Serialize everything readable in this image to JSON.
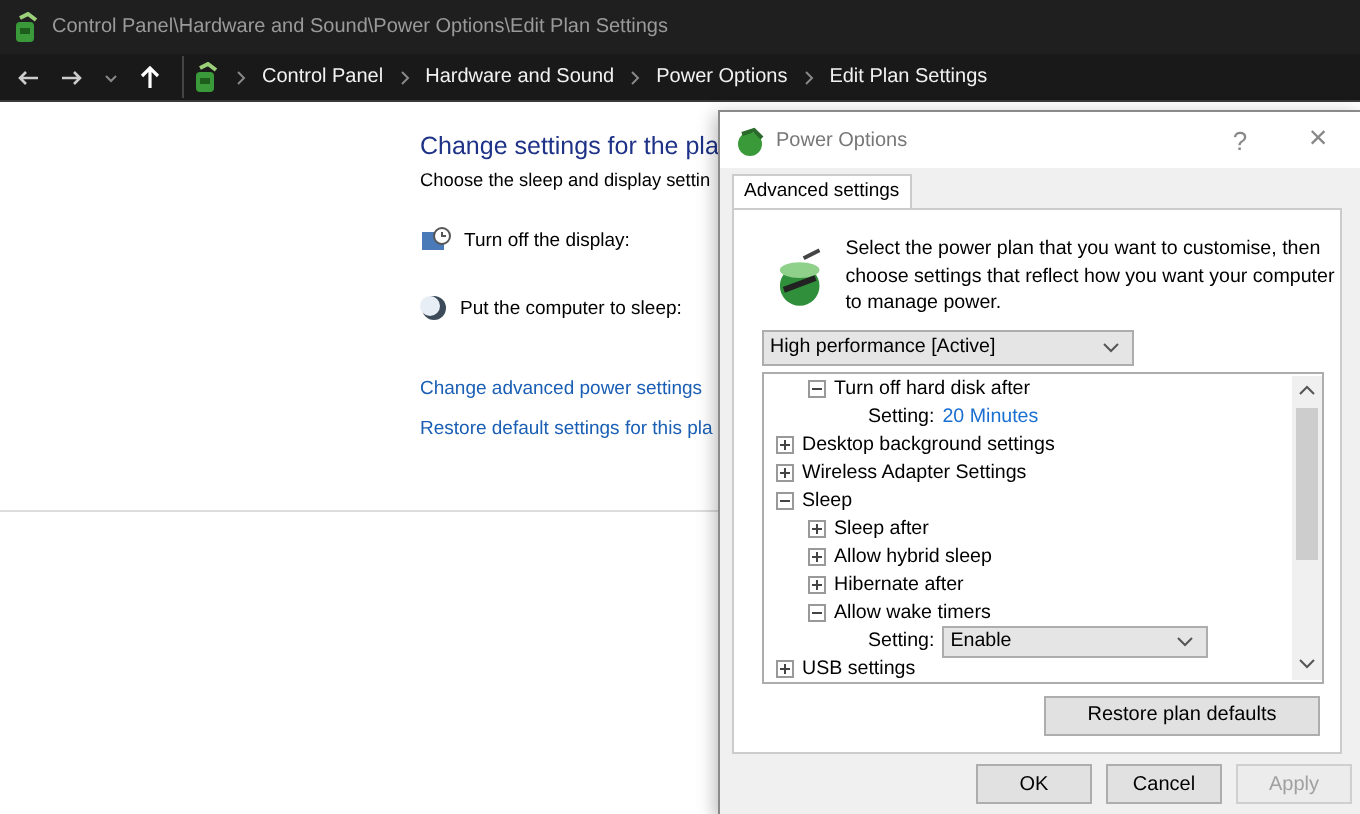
{
  "window": {
    "title": "Control Panel\\Hardware and Sound\\Power Options\\Edit Plan Settings"
  },
  "address_bar": {
    "breadcrumbs": [
      "Control Panel",
      "Hardware and Sound",
      "Power Options",
      "Edit Plan Settings"
    ]
  },
  "main": {
    "heading": "Change settings for the pla",
    "subheading": "Choose the sleep and display settin",
    "settings": [
      {
        "label": "Turn off the display:",
        "kind": "display"
      },
      {
        "label": "Put the computer to sleep:",
        "kind": "sleep"
      }
    ],
    "links": [
      "Change advanced power settings",
      "Restore default settings for this pla"
    ]
  },
  "dialog": {
    "title": "Power Options",
    "help": "?",
    "close": "×",
    "tabs": [
      {
        "label": "Advanced settings",
        "selected": true
      }
    ],
    "description": "Select the power plan that you want to customise, then choose settings that reflect how you want your computer to manage power.",
    "plan": "High performance [Active]",
    "tree": [
      {
        "children": [
          {
            "label": "Turn off hard disk after",
            "expanded": true,
            "setting": {
              "label": "Setting:",
              "value": "20 Minutes",
              "kind": "link"
            }
          }
        ]
      },
      {
        "label": "Desktop background settings",
        "expanded": false
      },
      {
        "label": "Wireless Adapter Settings",
        "expanded": false
      },
      {
        "label": "Sleep",
        "expanded": true,
        "children": [
          {
            "label": "Sleep after",
            "expanded": false
          },
          {
            "label": "Allow hybrid sleep",
            "expanded": false
          },
          {
            "label": "Hibernate after",
            "expanded": false
          },
          {
            "label": "Allow wake timers",
            "expanded": true,
            "setting": {
              "label": "Setting:",
              "value": "Enable",
              "kind": "dropdown"
            }
          }
        ]
      },
      {
        "label": "USB settings",
        "expanded": false
      }
    ],
    "restore_button": "Restore plan defaults",
    "buttons": [
      {
        "label": "OK",
        "disabled": false
      },
      {
        "label": "Cancel",
        "disabled": false
      },
      {
        "label": "Apply",
        "disabled": true
      }
    ]
  }
}
